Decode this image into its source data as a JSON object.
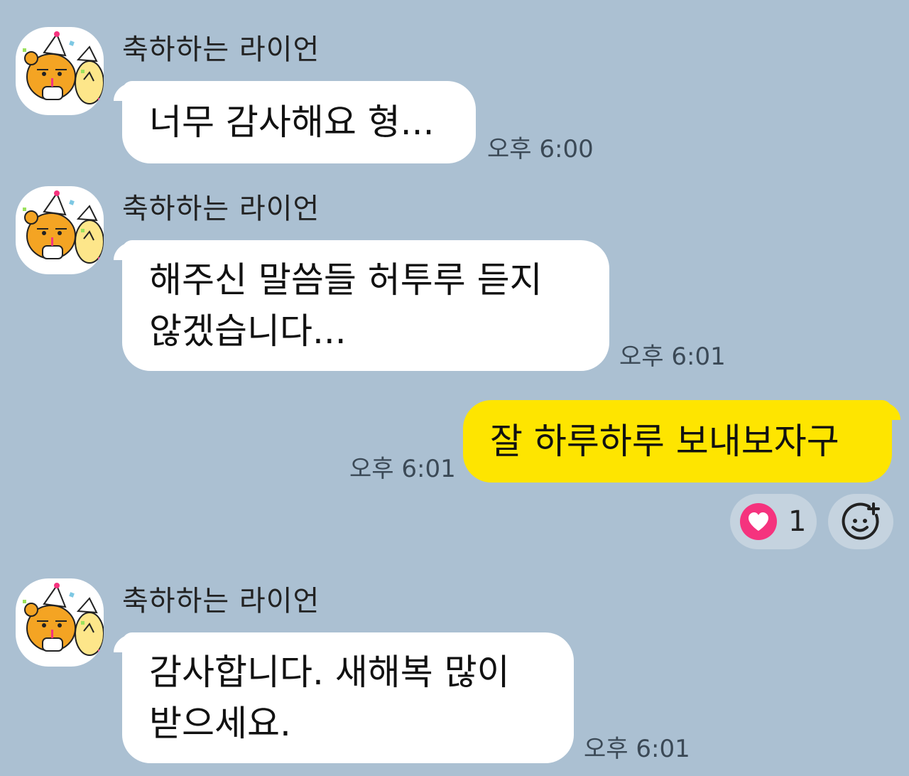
{
  "chat": {
    "messages": [
      {
        "sender": "축하하는 라이언",
        "lines": [
          "너무 감사해요 형..."
        ],
        "time": "오후 6:00"
      },
      {
        "sender": "축하하는 라이언",
        "lines": [
          "해주신 말씀들 허투루 듣지",
          "않겠습니다..."
        ],
        "time": "오후 6:01"
      },
      {
        "lines": [
          "잘 하루하루 보내보자구"
        ],
        "time": "오후 6:01",
        "reaction": {
          "icon": "heart-icon",
          "count": "1"
        }
      },
      {
        "sender": "축하하는 라이언",
        "lines": [
          "감사합니다. 새해복 많이",
          "받으세요."
        ],
        "time": "오후 6:01"
      }
    ]
  },
  "colors": {
    "background": "#abc0d2",
    "incoming_bubble": "#ffffff",
    "outgoing_bubble": "#fee500",
    "reaction_heart": "#f5337e"
  }
}
